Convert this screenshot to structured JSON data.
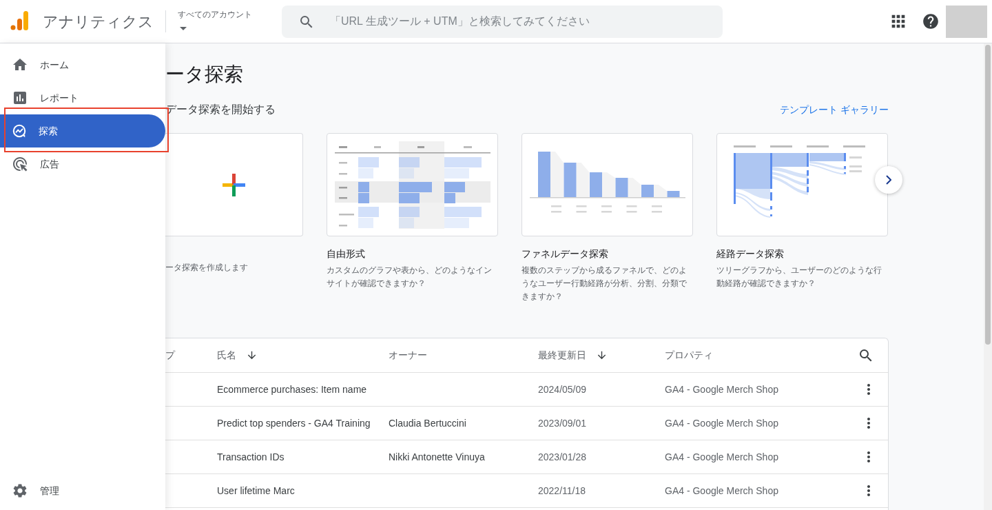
{
  "header": {
    "product": "アナリティクス",
    "account": "すべてのアカウント",
    "search": {
      "placeholder": "「URL 生成ツール + UTM」と検索してみてください"
    }
  },
  "sidebar": {
    "items": [
      {
        "label": "ホーム",
        "kind": "home",
        "selected": false,
        "highlighted": false
      },
      {
        "label": "レポート",
        "kind": "reports",
        "selected": false,
        "highlighted": false
      },
      {
        "label": "探索",
        "kind": "explore",
        "selected": true,
        "highlighted": true
      },
      {
        "label": "広告",
        "kind": "ads",
        "selected": false,
        "highlighted": false
      }
    ],
    "footer": {
      "label": "管理",
      "kind": "admin"
    }
  },
  "main": {
    "title": "ータ探索",
    "start_heading": "データ探索を開始する",
    "gallery_link": "テンプレート ギャラリー",
    "templates": [
      {
        "kind": "blank",
        "description": "ータ探索を作成します"
      },
      {
        "kind": "freeform",
        "title": "自由形式",
        "description": "カスタムのグラフや表から、どのようなインサイトが確認できますか？"
      },
      {
        "kind": "funnel",
        "title": "ファネルデータ探索",
        "description": "複数のステップから成るファネルで、どのようなユーザー行動経路が分析、分割、分類できますか？"
      },
      {
        "kind": "path",
        "title": "経路データ探索",
        "description": "ツリーグラフから、ユーザーのどのような行動経路が確認できますか？"
      }
    ],
    "table": {
      "columns": [
        {
          "label": "プ",
          "sorted": false
        },
        {
          "label": "氏名",
          "sorted": true
        },
        {
          "label": "オーナー",
          "sorted": false
        },
        {
          "label": "最終更新日",
          "sorted": true
        },
        {
          "label": "プロパティ",
          "sorted": false
        }
      ],
      "rows": [
        {
          "name": "Ecommerce purchases: Item name",
          "date": "2024/05/09",
          "property": "GA4 - Google Merch Shop"
        },
        {
          "name": "Predict top spenders - GA4 Training",
          "owner": "Claudia Bertuccini",
          "date": "2023/09/01",
          "property": "GA4 - Google Merch Shop"
        },
        {
          "name": "Transaction IDs",
          "owner": "Nikki Antonette Vinuya",
          "date": "2023/01/28",
          "property": "GA4 - Google Merch Shop"
        },
        {
          "name": "User lifetime Marc",
          "date": "2022/11/18",
          "property": "GA4 - Google Merch Shop"
        }
      ]
    }
  }
}
